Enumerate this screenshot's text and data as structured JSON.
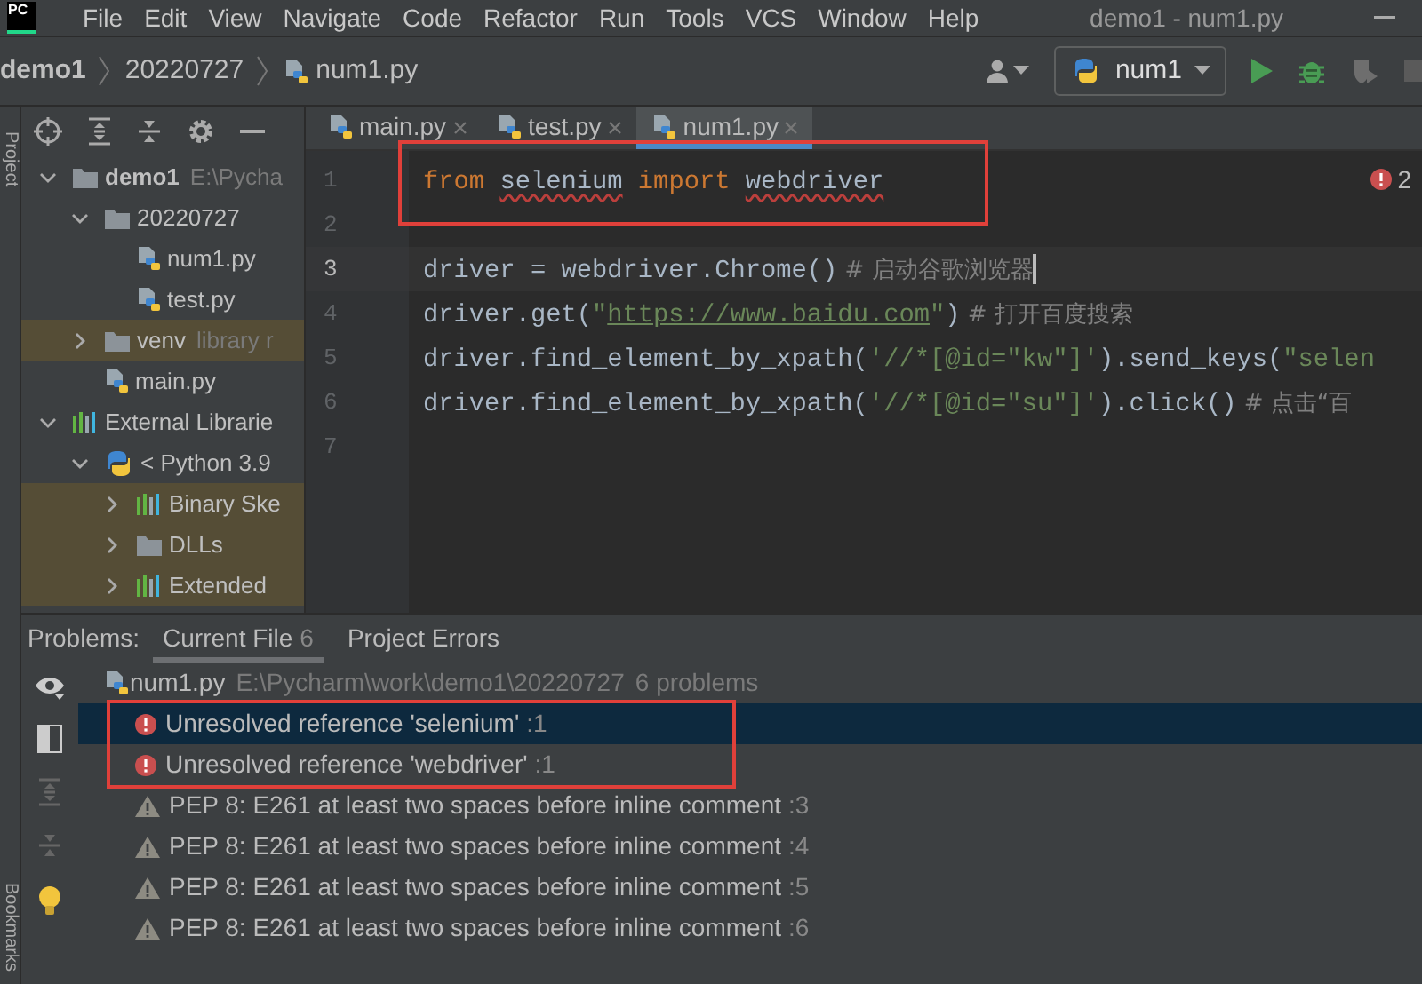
{
  "menu_bar": {
    "logo": "PC",
    "items": [
      "File",
      "Edit",
      "View",
      "Navigate",
      "Code",
      "Refactor",
      "Run",
      "Tools",
      "VCS",
      "Window",
      "Help"
    ],
    "title": "demo1 - num1.py"
  },
  "breadcrumb": [
    "demo1",
    "20220727",
    "num1.py"
  ],
  "run_config": {
    "label": "num1"
  },
  "side_strip": {
    "top": "Project",
    "bottom": "Bookmarks"
  },
  "project_tree": [
    {
      "label": "demo1",
      "hint": "E:\\Pycha",
      "kind": "folder",
      "expanded": true,
      "bold": true,
      "tinted": false,
      "children": [
        {
          "label": "20220727",
          "kind": "folder",
          "expanded": true,
          "tinted": false,
          "children": [
            {
              "label": "num1.py",
              "kind": "python-file",
              "tinted": false
            },
            {
              "label": "test.py",
              "kind": "python-file",
              "tinted": false
            }
          ]
        },
        {
          "label": "venv",
          "hint": "library r",
          "kind": "folder",
          "expanded": false,
          "tinted": true
        },
        {
          "label": "main.py",
          "kind": "python-file",
          "tinted": false
        }
      ]
    },
    {
      "label": "External Librarie",
      "kind": "library",
      "expanded": true,
      "tinted": false,
      "children": [
        {
          "label": "< Python 3.9",
          "kind": "python",
          "expanded": true,
          "tinted": false,
          "children": [
            {
              "label": "Binary Ske",
              "kind": "library",
              "expanded": false,
              "tinted": true
            },
            {
              "label": "DLLs",
              "kind": "folder",
              "expanded": false,
              "tinted": true
            },
            {
              "label": "Extended",
              "kind": "library",
              "expanded": false,
              "tinted": true
            }
          ]
        }
      ]
    }
  ],
  "editor": {
    "tabs": [
      {
        "label": "main.py",
        "selected": false
      },
      {
        "label": "test.py",
        "selected": false
      },
      {
        "label": "num1.py",
        "selected": true
      }
    ],
    "error_count": "2",
    "lines": [
      {
        "number": "1",
        "boxed": true,
        "current": false,
        "tokens": [
          {
            "kind": "keyword",
            "text": "from "
          },
          {
            "kind": "unresolved",
            "text": "selenium"
          },
          {
            "kind": "keyword",
            "text": " import "
          },
          {
            "kind": "unresolved",
            "text": "webdriver"
          }
        ]
      },
      {
        "number": "2",
        "boxed": false,
        "current": false
      },
      {
        "number": "3",
        "boxed": false,
        "current": true,
        "tokens": [
          {
            "kind": "plain",
            "text": "driver = webdriver.Chrome()"
          },
          {
            "kind": "comment",
            "text": " # 启动谷歌浏览器"
          }
        ]
      },
      {
        "number": "4",
        "boxed": false,
        "current": false,
        "tokens": [
          {
            "kind": "plain",
            "text": "driver.get("
          },
          {
            "kind": "string",
            "text": "\""
          },
          {
            "kind": "url",
            "text": "https://www.baidu.com"
          },
          {
            "kind": "string",
            "text": "\""
          },
          {
            "kind": "plain",
            "text": ")"
          },
          {
            "kind": "comment",
            "text": " # 打开百度搜索"
          }
        ]
      },
      {
        "number": "5",
        "boxed": false,
        "current": false,
        "tokens": [
          {
            "kind": "plain",
            "text": "driver.find_element_by_xpath("
          },
          {
            "kind": "string",
            "text": "'//*[@id=\"kw\"]'"
          },
          {
            "kind": "plain",
            "text": ").send_keys("
          },
          {
            "kind": "string",
            "text": "\"selen"
          }
        ]
      },
      {
        "number": "6",
        "boxed": false,
        "current": false,
        "tokens": [
          {
            "kind": "plain",
            "text": "driver.find_element_by_xpath("
          },
          {
            "kind": "string",
            "text": "'//*[@id=\"su\"]'"
          },
          {
            "kind": "plain",
            "text": ").click()"
          },
          {
            "kind": "comment",
            "text": " # 点击“百"
          }
        ]
      },
      {
        "number": "7",
        "boxed": false,
        "current": false
      }
    ]
  },
  "problems": {
    "title": "Problems:",
    "tabs": [
      {
        "label": "Current File",
        "count": "6",
        "selected": true
      },
      {
        "label": "Project Errors",
        "selected": false
      }
    ],
    "file": {
      "name": "num1.py",
      "path": "E:\\Pycharm\\work\\demo1\\20220727",
      "summary": "6 problems"
    },
    "items": [
      {
        "kind": "error",
        "message": "Unresolved reference 'selenium'",
        "location": ":1",
        "selected": true,
        "boxed": true
      },
      {
        "kind": "error",
        "message": "Unresolved reference 'webdriver'",
        "location": ":1",
        "selected": false,
        "boxed": true
      },
      {
        "kind": "warning",
        "message": "PEP 8: E261 at least two spaces before inline comment",
        "location": ":3",
        "selected": false,
        "boxed": false
      },
      {
        "kind": "warning",
        "message": "PEP 8: E261 at least two spaces before inline comment",
        "location": ":4",
        "selected": false,
        "boxed": false
      },
      {
        "kind": "warning",
        "message": "PEP 8: E261 at least two spaces before inline comment",
        "location": ":5",
        "selected": false,
        "boxed": false
      },
      {
        "kind": "warning",
        "message": "PEP 8: E261 at least two spaces before inline comment",
        "location": ":6",
        "selected": false,
        "boxed": false
      }
    ]
  }
}
